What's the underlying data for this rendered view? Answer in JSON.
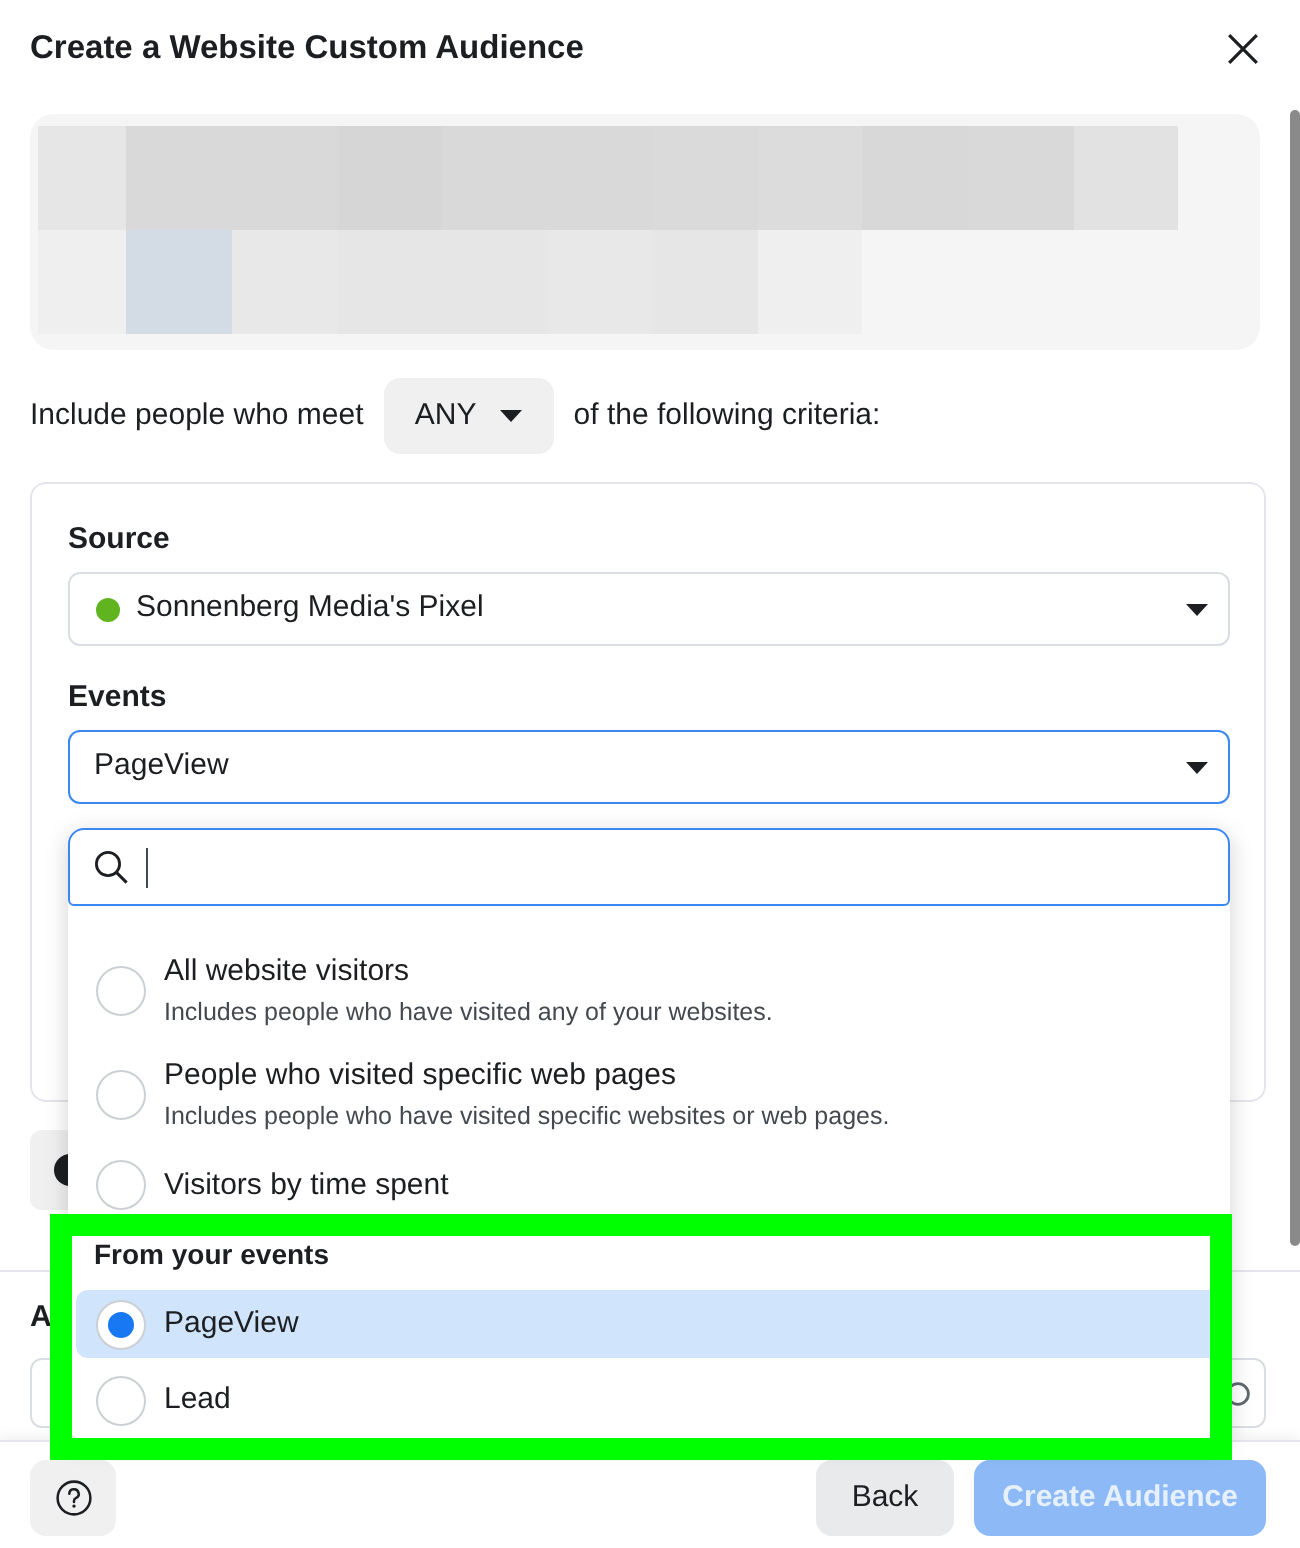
{
  "dialog": {
    "title": "Create a Website Custom Audience"
  },
  "criteria": {
    "prefix": "Include people who meet",
    "match": "ANY",
    "suffix": "of the following criteria:"
  },
  "source": {
    "label": "Source",
    "value": "Sonnenberg Media's Pixel",
    "active": true
  },
  "events": {
    "label": "Events",
    "value": "PageView",
    "expanded": true
  },
  "event_menu": {
    "groups": [
      {
        "highlighted": false,
        "options": [
          {
            "label": "All website visitors",
            "description": "Includes people who have visited any of your websites.",
            "selected": false
          },
          {
            "label": "People who visited specific web pages",
            "description": "Includes people who have visited specific websites or web pages.",
            "selected": false
          },
          {
            "label": "Visitors by time spent",
            "selected": false
          }
        ]
      },
      {
        "heading": "From your events",
        "highlighted": true,
        "options": [
          {
            "label": "PageView",
            "selected": true
          },
          {
            "label": "Lead",
            "selected": false
          }
        ]
      }
    ]
  },
  "covered_field": {
    "label": "A"
  },
  "footer": {
    "buttons": [
      {
        "label": "Back",
        "kind": "secondary",
        "disabled": false
      },
      {
        "label": "Create Audience",
        "kind": "primary",
        "disabled": true
      }
    ]
  }
}
